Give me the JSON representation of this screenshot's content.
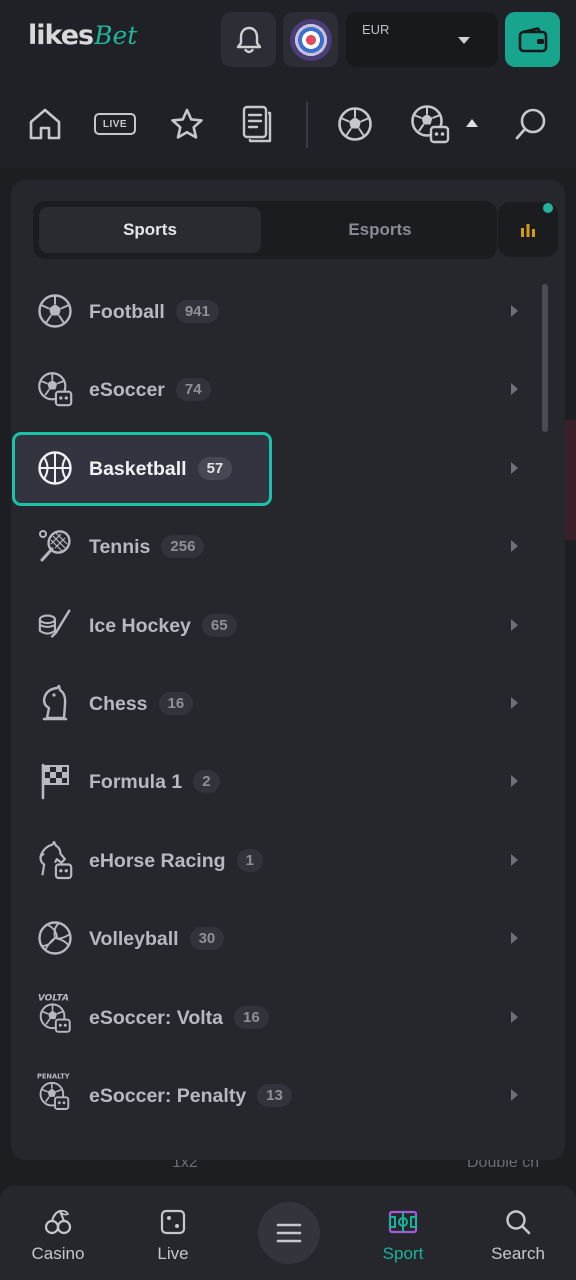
{
  "header": {
    "logo_main": "likes",
    "logo_accent": "Bet",
    "currency_code": "EUR"
  },
  "nav_icons": [
    "home-icon",
    "live-icon",
    "star-icon",
    "betslip-icon",
    "soccer-ball-icon",
    "esoccer-icon",
    "search-icon"
  ],
  "nav": {
    "live_label": "LIVE"
  },
  "panel": {
    "tabs": [
      {
        "label": "Sports",
        "active": true
      },
      {
        "label": "Esports",
        "active": false
      }
    ],
    "sports": [
      {
        "name": "Football",
        "count": "941",
        "icon": "soccer-ball-icon"
      },
      {
        "name": "eSoccer",
        "count": "74",
        "icon": "esoccer-icon"
      },
      {
        "name": "Basketball",
        "count": "57",
        "icon": "basketball-icon",
        "selected": true
      },
      {
        "name": "Tennis",
        "count": "256",
        "icon": "tennis-racket-icon"
      },
      {
        "name": "Ice Hockey",
        "count": "65",
        "icon": "ice-hockey-icon"
      },
      {
        "name": "Chess",
        "count": "16",
        "icon": "chess-knight-icon"
      },
      {
        "name": "Formula 1",
        "count": "2",
        "icon": "checkered-flag-icon"
      },
      {
        "name": "eHorse Racing",
        "count": "1",
        "icon": "ehorse-icon"
      },
      {
        "name": "Volleyball",
        "count": "30",
        "icon": "volleyball-icon"
      },
      {
        "name": "eSoccer: Volta",
        "count": "16",
        "icon": "esoccer-volta-icon",
        "badge": "VOLTA"
      },
      {
        "name": "eSoccer: Penalty",
        "count": "13",
        "icon": "esoccer-penalty-icon",
        "badge": "PENALTY"
      }
    ]
  },
  "background": {
    "text_2": "1x2",
    "text_3": "Double ch"
  },
  "bottom_nav": [
    {
      "label": "Casino",
      "icon": "cherries-icon"
    },
    {
      "label": "Live",
      "icon": "dice-icon"
    },
    {
      "label": "",
      "icon": "menu-icon"
    },
    {
      "label": "Sport",
      "icon": "sport-field-icon",
      "active": true
    },
    {
      "label": "Search",
      "icon": "search-icon"
    }
  ],
  "colors": {
    "accent": "#19c2a8",
    "wallet": "#17a58d",
    "background": "#1d1e22",
    "panel": "#26272d"
  }
}
